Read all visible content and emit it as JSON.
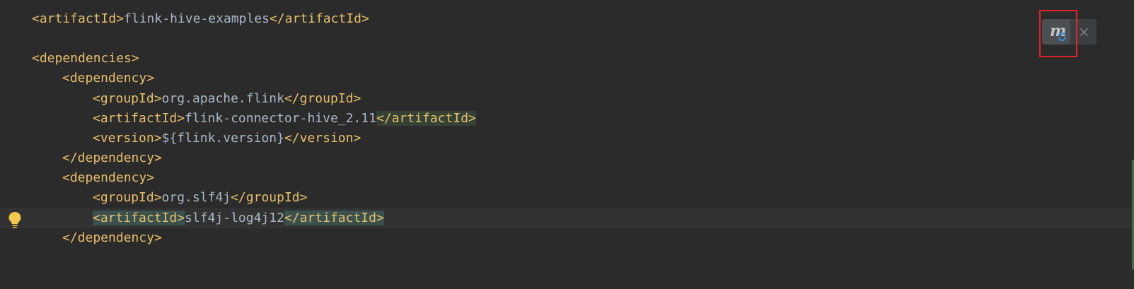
{
  "lines": [
    {
      "open": "<artifactId>",
      "text": "flink-hive-examples",
      "close": "</artifactId>"
    },
    {
      "open": "<dependencies>"
    },
    {
      "open": "<dependency>"
    },
    {
      "open": "<groupId>",
      "text": "org.apache.flink",
      "close": "</groupId>"
    },
    {
      "open": "<artifactId>",
      "text": "flink-connector-hive_2.11",
      "close": "</artifactId>"
    },
    {
      "open": "<version>",
      "text": "${flink.version}",
      "close": "</version>"
    },
    {
      "open": "</dependency>"
    },
    {
      "open": "<dependency>"
    },
    {
      "open": "<groupId>",
      "text": "org.slf4j",
      "close": "</groupId>"
    },
    {
      "open": "<artifactId>",
      "text": "slf4j-log4j12",
      "close": "</artifactId>"
    },
    {
      "open": "</dependency>"
    }
  ],
  "maven_popup": {
    "reload_icon": "maven-reload-icon",
    "close_icon": "close-icon",
    "close_glyph": "×"
  },
  "gutter": {
    "icon": "lightbulb-icon"
  },
  "colors": {
    "background": "#2b2b2b",
    "tag": "#e8bf6a",
    "text": "#a9b7c6",
    "highlight": "#344134",
    "annotation": "#e0242b"
  }
}
